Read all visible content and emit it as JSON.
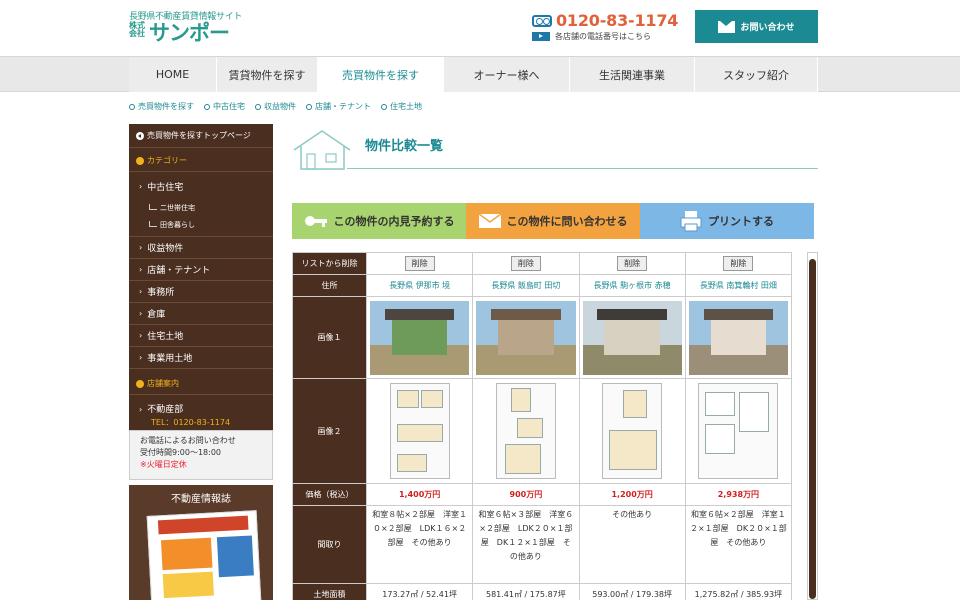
{
  "header": {
    "site_subtitle": "長野県不動産賃貸情報サイト",
    "logo_kabu": "株式会社",
    "logo_name": "サンポー",
    "phone": "0120-83-1174",
    "phone_note": "各店舗の電話番号はこちら",
    "contact_label": "お問い合わせ"
  },
  "nav": [
    "HOME",
    "賃貸物件を探す",
    "売買物件を探す",
    "オーナー様へ",
    "生活関連事業",
    "スタッフ紹介"
  ],
  "subnav": [
    "売買物件を探す",
    "中古住宅",
    "収益物件",
    "店舗・テナント",
    "住宅土地"
  ],
  "sidebar": {
    "top_link": "売買物件を探すトップページ",
    "category_head": "カテゴリー",
    "items": [
      "中古住宅",
      "収益物件",
      "店舗・テナント",
      "事務所",
      "倉庫",
      "住宅土地",
      "事業用土地"
    ],
    "sub_items": [
      "二世帯住宅",
      "田舎暮らし"
    ],
    "store_head": "店舗案内",
    "store_name": "不動産部",
    "store_tel": "TEL：0120-83-1174",
    "info_line1": "お電話によるお問い合わせ",
    "info_line2": "受付時間9:00～18:00",
    "info_line3": "※火曜日定休",
    "news_title": "不動産情報誌"
  },
  "main": {
    "title": "物件比較一覧",
    "action_view": "この物件の内見予約する",
    "action_ask": "この物件に問い合わせる",
    "action_print": "プリントする"
  },
  "table": {
    "row_headers": [
      "リストから削除",
      "住所",
      "画像１",
      "画像２",
      "価格（税込）",
      "間取り",
      "土地面積"
    ],
    "delete_label": "削除",
    "properties": [
      {
        "address": "長野県 伊那市 境",
        "price": "1,400万円",
        "layout": "和室８帖×２部屋　洋室１０×２部屋　LDK１６×２部屋　その他あり",
        "land": "173.27㎡ / 52.41坪"
      },
      {
        "address": "長野県 飯島町 田切",
        "price": "900万円",
        "layout": "和室６帖×３部屋　洋室６×２部屋　LDK２０×１部屋　DK１２×１部屋　その他あり",
        "land": "581.41㎡ / 175.87坪"
      },
      {
        "address": "長野県 駒ヶ根市 赤穂",
        "price": "1,200万円",
        "layout": "その他あり",
        "land": "593.00㎡ / 179.38坪"
      },
      {
        "address": "長野県 南箕輪村 田畑",
        "price": "2,938万円",
        "layout": "和室６帖×２部屋　洋室１２×１部屋　DK２０×１部屋　その他あり",
        "land": "1,275.82㎡ / 385.93坪"
      }
    ]
  },
  "colors": {
    "teal": "#1b8a93",
    "brown": "#4a2e20",
    "orange_phone": "#e0613a",
    "price_red": "#d2201f"
  }
}
